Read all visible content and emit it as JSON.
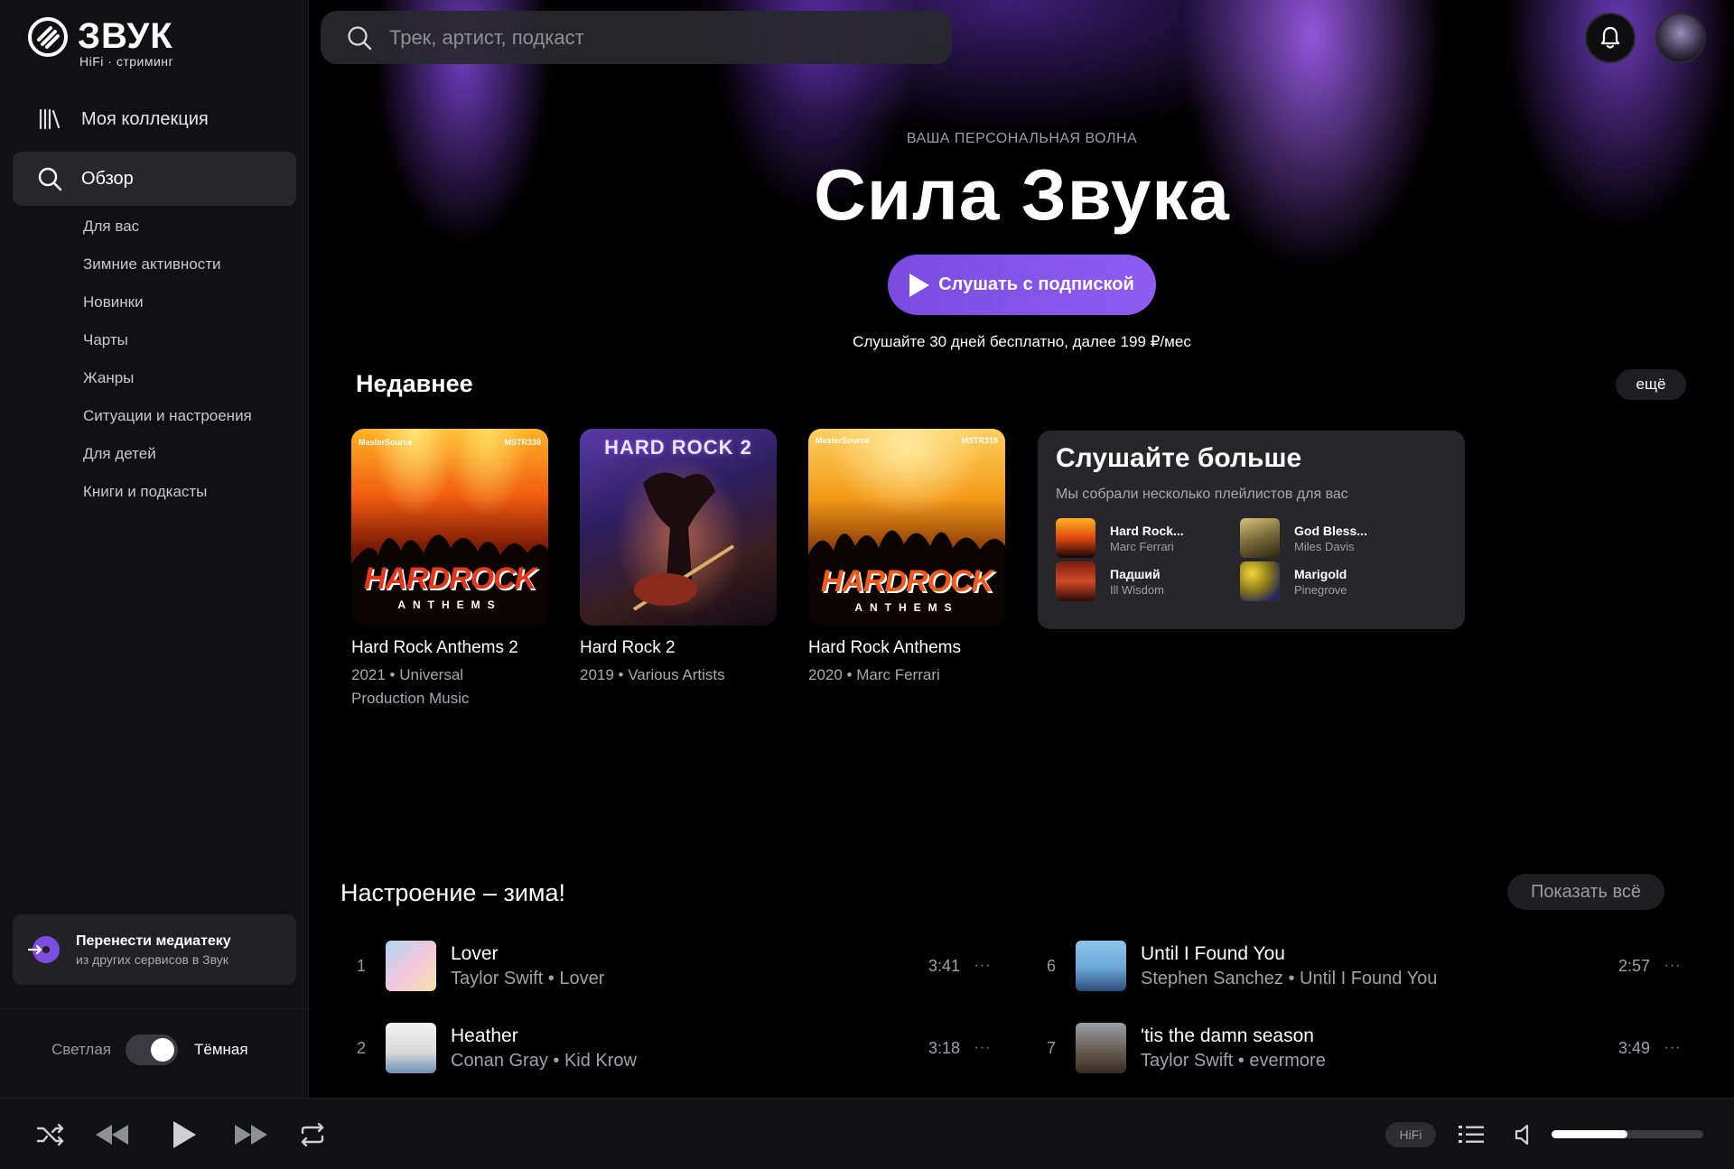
{
  "brand": {
    "title": "ЗВУК",
    "subtitle": "HiFi · стриминг"
  },
  "sidebar": {
    "collection_label": "Моя коллекция",
    "browse_label": "Обзор",
    "subnav": [
      "Для вас",
      "Зимние активности",
      "Новинки",
      "Чарты",
      "Жанры",
      "Ситуации и настроения",
      "Для детей",
      "Книги и подкасты"
    ],
    "migrate": {
      "title": "Перенести медиатеку",
      "subtitle": "из других сервисов в Звук"
    },
    "theme": {
      "light_label": "Светлая",
      "dark_label": "Тёмная",
      "dark_enabled": true
    }
  },
  "search": {
    "placeholder": "Трек, артист, подкаст"
  },
  "hero": {
    "kicker": "ВАША ПЕРСОНАЛЬНАЯ ВОЛНА",
    "title": "Сила Звука",
    "button_label": "Слушать с подпиской",
    "note": "Слушайте 30 дней бесплатно, далее 199 ₽/мес"
  },
  "recent": {
    "title": "Недавнее",
    "more_label": "ещё",
    "items": [
      {
        "title": "Hard Rock Anthems 2",
        "subtitle": "2021 • Universal Production Music",
        "cover_text": "HARDROCK",
        "cover_sub": "ANTHEMS",
        "cover_tag": "MSTR338",
        "cover_brand": "MasterSource"
      },
      {
        "title": "Hard Rock 2",
        "subtitle": "2019 • Various Artists",
        "cover_text": "HARD ROCK 2"
      },
      {
        "title": "Hard Rock Anthems",
        "subtitle": "2020 • Marc Ferrari",
        "cover_text": "HARDROCK",
        "cover_sub": "ANTHEMS",
        "cover_tag": "MSTR319",
        "cover_brand": "MasterSource"
      }
    ],
    "promo": {
      "title": "Слушайте больше",
      "subtitle": "Мы собрали несколько плейлистов для вас",
      "playlists": [
        {
          "name": "Hard Rock...",
          "artist": "Marc Ferrari"
        },
        {
          "name": "God Bless...",
          "artist": "Miles Davis"
        },
        {
          "name": "Падший",
          "artist": "Ill Wisdom"
        },
        {
          "name": "Marigold",
          "artist": "Pinegrove"
        }
      ]
    }
  },
  "mood": {
    "title": "Настроение – зима!",
    "show_all_label": "Показать всё",
    "tracks": [
      {
        "num": "1",
        "title": "Lover",
        "artist": "Taylor Swift",
        "album": "Lover",
        "sub": "Taylor Swift • Lover",
        "duration": "3:41"
      },
      {
        "num": "2",
        "title": "Heather",
        "artist": "Conan Gray",
        "album": "Kid Krow",
        "sub": "Conan Gray • Kid Krow",
        "duration": "3:18"
      },
      {
        "num": "6",
        "title": "Until I Found You",
        "artist": "Stephen Sanchez",
        "album": "Until I Found You",
        "sub": "Stephen Sanchez • Until I Found You",
        "duration": "2:57"
      },
      {
        "num": "7",
        "title": "'tis the damn season",
        "artist": "Taylor Swift",
        "album": "evermore",
        "sub": "Taylor Swift • evermore",
        "duration": "3:49"
      }
    ],
    "more_glyph": "···"
  },
  "player": {
    "quality_label": "HiFi",
    "volume": 0.5
  },
  "colors": {
    "accent": "#8b5cf6",
    "background": "#000000",
    "sidebar": "#111113"
  }
}
